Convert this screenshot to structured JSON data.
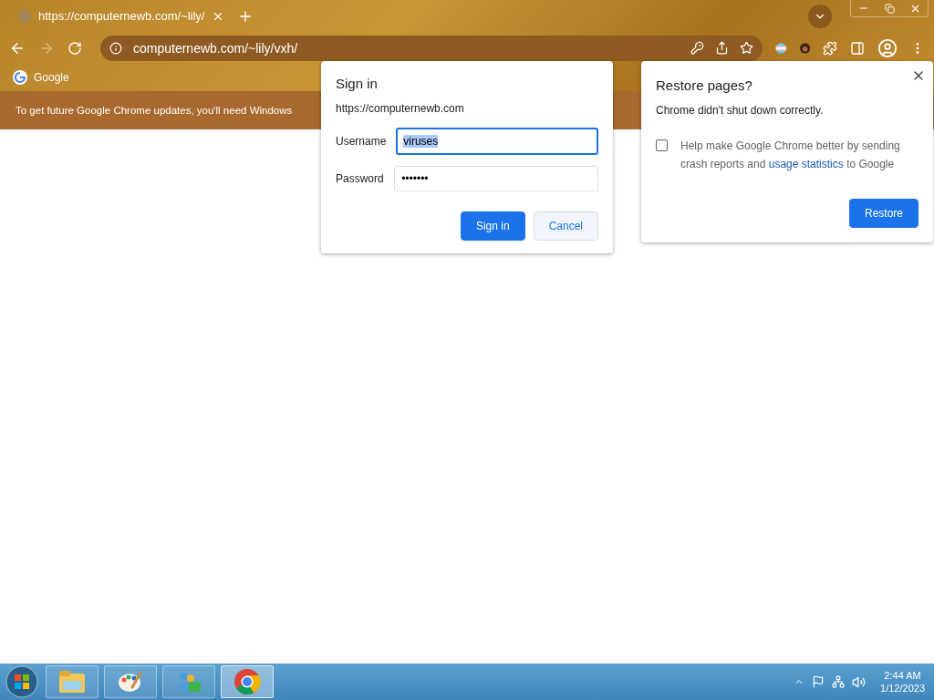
{
  "tab": {
    "title": "https://computernewb.com/~lily/"
  },
  "address_bar": {
    "url": "computernewb.com/~lily/vxh/"
  },
  "bookmarks": [
    {
      "label": "Google"
    }
  ],
  "infobar": {
    "message": "To get future Google Chrome updates, you'll need Windows"
  },
  "sign_in_dialog": {
    "title": "Sign in",
    "origin": "https://computernewb.com",
    "fields": [
      {
        "label": "Username",
        "value": "viruses",
        "focused": true,
        "text_selected": true
      },
      {
        "label": "Password",
        "value": "•••••••",
        "focused": false,
        "text_selected": false
      }
    ],
    "buttons": [
      {
        "label": "Sign in",
        "primary": true
      },
      {
        "label": "Cancel",
        "primary": false
      }
    ]
  },
  "restore_dialog": {
    "title": "Restore pages?",
    "message": "Chrome didn't shut down correctly.",
    "checkbox": {
      "checked": false,
      "text_before": "Help make Google Chrome better by sending crash reports and",
      "link": "usage statistics",
      "text_after": "to Google"
    },
    "button": "Restore"
  },
  "taskbar": {
    "apps": [
      {
        "kind": "folder",
        "active": false
      },
      {
        "kind": "paint",
        "active": false
      },
      {
        "kind": "people",
        "active": false
      },
      {
        "kind": "chrome",
        "active": true
      }
    ],
    "time": "2:44 AM",
    "date": "1/12/2023"
  }
}
